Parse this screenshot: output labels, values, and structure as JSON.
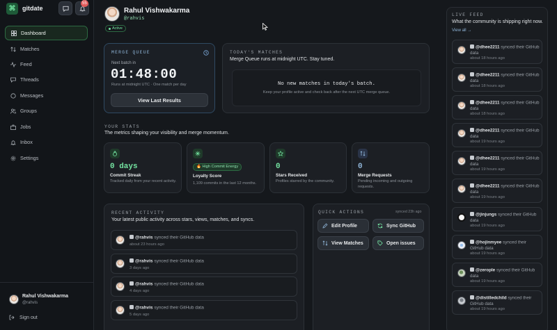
{
  "app": {
    "name": "gitdate",
    "notification_count": "55"
  },
  "sidebar": {
    "items": [
      {
        "label": "Dashboard",
        "icon": "grid-icon",
        "active": true
      },
      {
        "label": "Matches",
        "icon": "swap-icon"
      },
      {
        "label": "Feed",
        "icon": "pulse-icon"
      },
      {
        "label": "Threads",
        "icon": "threads-icon"
      },
      {
        "label": "Messages",
        "icon": "message-icon"
      },
      {
        "label": "Groups",
        "icon": "groups-icon"
      },
      {
        "label": "Jobs",
        "icon": "briefcase-icon"
      },
      {
        "label": "Inbox",
        "icon": "bell-icon"
      },
      {
        "label": "Settings",
        "icon": "gear-icon"
      }
    ],
    "user": {
      "name": "Rahul Vishwakarma",
      "handle": "@rahvis"
    },
    "signout": "Sign out"
  },
  "profile": {
    "name": "Rahul Vishwakarma",
    "handle": "@rahvis",
    "status": "Active"
  },
  "merge_queue": {
    "title": "Merge Queue",
    "next_label": "Next batch in",
    "countdown": "01:48:00",
    "note": "Runs at midnight UTC · One match per day",
    "button": "View Last Results"
  },
  "todays_matches": {
    "title": "Today's Matches",
    "subtitle": "Merge Queue runs at midnight UTC. Stay tuned.",
    "empty_title": "No new matches in today's batch.",
    "empty_desc": "Keep your profile active and check back after the next UTC merge queue."
  },
  "stats": {
    "title": "Your Stats",
    "subtitle": "The metrics shaping your visibility and merge momentum.",
    "cards": [
      {
        "value": "0 days",
        "label": "Commit Streak",
        "desc": "Tracked daily from your recent activity.",
        "icon": "flame-icon"
      },
      {
        "value": "",
        "pill": "🔥 High Commit Energy",
        "label": "Loyalty Score",
        "desc": "1,109 commits in the last 12 months.",
        "icon": "sparkle-icon"
      },
      {
        "value": "0",
        "label": "Stars Received",
        "desc": "Profiles starred by the community.",
        "icon": "star-icon"
      },
      {
        "value": "0",
        "label": "Merge Requests",
        "desc": "Pending incoming and outgoing requests.",
        "icon": "merge-icon"
      }
    ]
  },
  "recent_activity": {
    "title": "Recent Activity",
    "subtitle": "Your latest public activity across stars, views, matches, and syncs.",
    "items": [
      {
        "user": "@rahvis",
        "action": "synced their GitHub data",
        "time": "about 23 hours ago"
      },
      {
        "user": "@rahvis",
        "action": "synced their GitHub data",
        "time": "3 days ago"
      },
      {
        "user": "@rahvis",
        "action": "synced their GitHub data",
        "time": "4 days ago"
      },
      {
        "user": "@rahvis",
        "action": "synced their GitHub data",
        "time": "5 days ago"
      }
    ]
  },
  "quick_actions": {
    "title": "Quick Actions",
    "meta": "synced 23h ago",
    "buttons": [
      {
        "label": "Edit Profile",
        "icon": "pencil-icon"
      },
      {
        "label": "Sync GitHub",
        "icon": "sync-icon"
      },
      {
        "label": "View Matches",
        "icon": "swap-icon"
      },
      {
        "label": "Open issues",
        "icon": "tag-icon"
      }
    ]
  },
  "live_feed": {
    "title": "Live Feed",
    "subtitle": "What the community is shipping right now.",
    "view_all": "View all →",
    "items": [
      {
        "user": "@dhee2211",
        "action": "synced their GitHub data",
        "time": "about 18 hours ago"
      },
      {
        "user": "@dhee2211",
        "action": "synced their GitHub data",
        "time": "about 18 hours ago"
      },
      {
        "user": "@dhee2211",
        "action": "synced their GitHub data",
        "time": "about 18 hours ago"
      },
      {
        "user": "@dhee2211",
        "action": "synced their GitHub data",
        "time": "about 19 hours ago"
      },
      {
        "user": "@dhee2211",
        "action": "synced their GitHub data",
        "time": "about 19 hours ago"
      },
      {
        "user": "@dhee2211",
        "action": "synced their GitHub data",
        "time": "about 19 hours ago"
      },
      {
        "user": "@jinjungs",
        "action": "synced their GitHub data",
        "time": "about 19 hours ago"
      },
      {
        "user": "@hojinmyee",
        "action": "synced their GitHub data",
        "time": "about 19 hours ago"
      },
      {
        "user": "@zerople",
        "action": "synced their GitHub data",
        "time": "about 19 hours ago"
      },
      {
        "user": "@distilledchild",
        "action": "synced their GitHub data",
        "time": "about 19 hours ago"
      }
    ]
  },
  "colors": {
    "accent": "#74e3a1",
    "background": "#15181c",
    "card": "#1c1f24",
    "danger": "#e05a5a"
  }
}
